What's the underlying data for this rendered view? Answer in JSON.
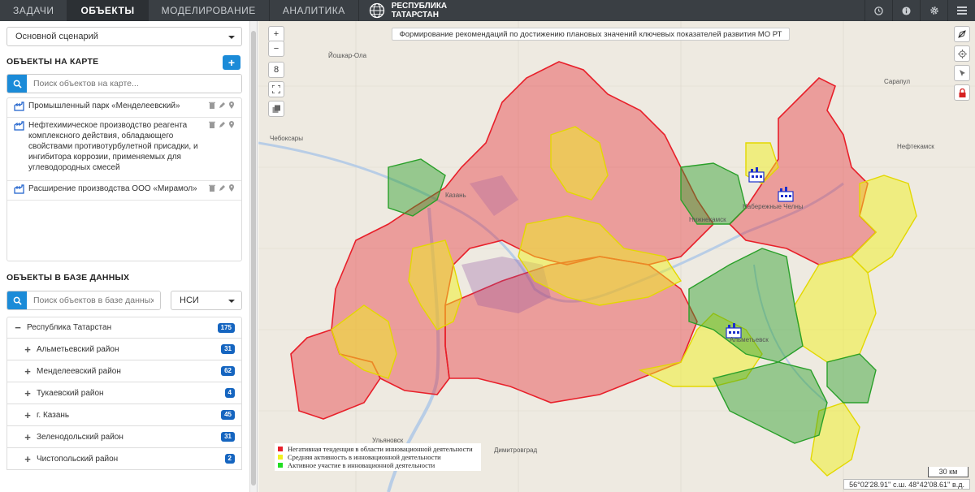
{
  "nav": {
    "tabs": [
      {
        "label": "ЗАДАЧИ",
        "active": false
      },
      {
        "label": "ОБЪЕКТЫ",
        "active": true
      },
      {
        "label": "МОДЕЛИРОВАНИЕ",
        "active": false
      },
      {
        "label": "АНАЛИТИКА",
        "active": false
      }
    ],
    "brand_line1": "РЕСПУБЛИКА",
    "brand_line2": "ТАТАРСТАН",
    "icons": [
      "clock-icon",
      "info-icon",
      "gear-icon",
      "menu-icon"
    ]
  },
  "sidebar": {
    "scenario": "Основной сценарий",
    "map_objects_title": "ОБЪЕКТЫ НА КАРТЕ",
    "add_label": "+",
    "map_search_placeholder": "Поиск объектов на карте...",
    "objects": [
      "Промышленный парк «Менделеевский»",
      "Нефтехимическое производство реагента комплексного действия, обладающего свойствами противотурбулетной присадки, и ингибитора коррозии, применяемых для углеводородных смесей",
      "Расширение производства ООО «Мирамол»"
    ],
    "db_title": "ОБЪЕКТЫ В БАЗЕ ДАННЫХ",
    "db_search_placeholder": "Поиск объектов в базе данных...",
    "db_filter": "НСИ",
    "tree": [
      {
        "sign": "−",
        "label": "Республика Татарстан",
        "count": "175",
        "indent": 0
      },
      {
        "sign": "+",
        "label": "Альметьевский район",
        "count": "31",
        "indent": 1
      },
      {
        "sign": "+",
        "label": "Менделеевский район",
        "count": "62",
        "indent": 1
      },
      {
        "sign": "+",
        "label": "Тукаевский район",
        "count": "4",
        "indent": 1
      },
      {
        "sign": "+",
        "label": "г. Казань",
        "count": "45",
        "indent": 1
      },
      {
        "sign": "+",
        "label": "Зеленодольский район",
        "count": "31",
        "indent": 1
      },
      {
        "sign": "+",
        "label": "Чистопольский район",
        "count": "2",
        "indent": 1
      }
    ]
  },
  "map": {
    "title": "Формирование рекомендаций по достижению плановых значений ключевых показателей развития МО РТ",
    "zoom_in": "+",
    "zoom_out": "−",
    "zoom_level": "8",
    "legend": [
      {
        "color": "#e8202a",
        "label": "Негативная тенденция в области инновационной деятельности"
      },
      {
        "color": "#f0f020",
        "label": "Средняя активность в инновационной деятельности"
      },
      {
        "color": "#22dd22",
        "label": "Активное участие в инновационной деятельности"
      }
    ],
    "scale": "30 км",
    "coords": "56°02'28.91'' с.ш. 48°42'08.61'' в.д.",
    "places": [
      "Чебоксары",
      "Казань",
      "Набережные Челны",
      "Нижнекамск",
      "Альметьевск",
      "Ульяновск",
      "Сарапул",
      "Нефтекамск",
      "Йошкар-Ола",
      "Димитровград"
    ],
    "colors": {
      "red": "#e8202a",
      "yellow": "#f0f020",
      "green": "#2aa02a",
      "accent": "#1b8bd8"
    }
  }
}
